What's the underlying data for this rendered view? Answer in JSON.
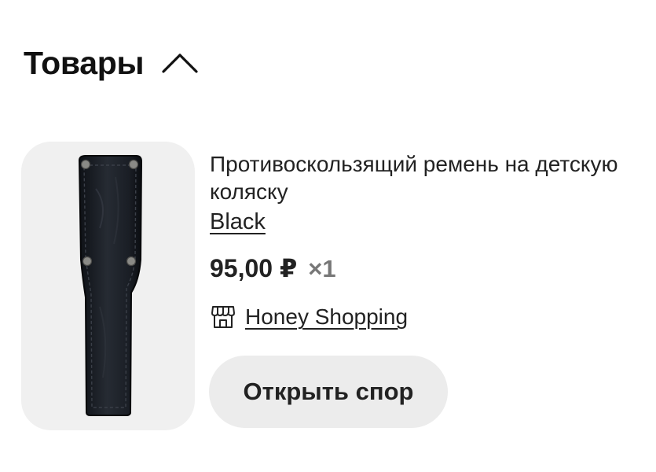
{
  "section": {
    "title": "Товары",
    "toggle_icon": "chevron-up-icon"
  },
  "product": {
    "image_icon": "stroller-strap-image",
    "name": "Противоскользящий ремень на детскую коляску",
    "variant": "Black",
    "price": "95,00 ₽",
    "quantity": "×1",
    "store": {
      "icon": "store-icon",
      "name": "Honey Shopping"
    },
    "dispute_button": "Открыть спор"
  },
  "colors": {
    "text": "#111111",
    "muted": "#777777",
    "image_bg": "#f0f0f0",
    "button_bg": "#ececec"
  }
}
